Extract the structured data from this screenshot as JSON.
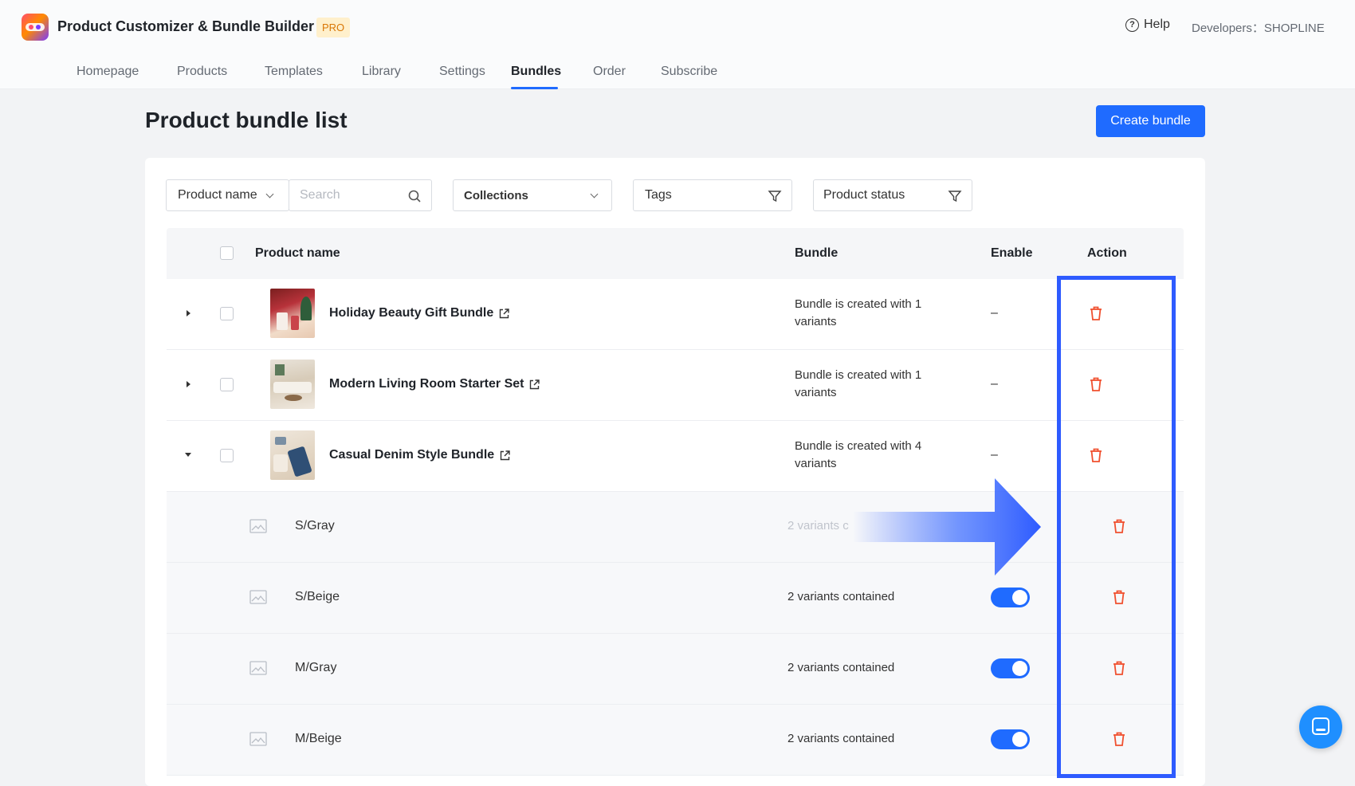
{
  "app": {
    "title": "Product Customizer & Bundle Builder",
    "badge": "PRO",
    "help_label": "Help",
    "developers_label": "Developers：SHOPLINE"
  },
  "nav": {
    "tabs": [
      "Homepage",
      "Products",
      "Templates",
      "Library",
      "Settings",
      "Bundles",
      "Order",
      "Subscribe"
    ],
    "active": "Bundles"
  },
  "page": {
    "title": "Product bundle list",
    "create_button": "Create bundle"
  },
  "filters": {
    "product_name_select": "Product name",
    "search_placeholder": "Search",
    "collections": "Collections",
    "tags": "Tags",
    "product_status": "Product status"
  },
  "table": {
    "headers": {
      "product_name": "Product name",
      "bundle": "Bundle",
      "enable": "Enable",
      "action": "Action"
    },
    "products": [
      {
        "name": "Holiday Beauty Gift Bundle",
        "bundle_line1": "Bundle is created with 1",
        "bundle_line2": "variants",
        "enable": "–",
        "expanded": false
      },
      {
        "name": "Modern Living Room Starter Set",
        "bundle_line1": "Bundle is created with 1",
        "bundle_line2": "variants",
        "enable": "–",
        "expanded": false
      },
      {
        "name": "Casual Denim Style Bundle",
        "bundle_line1": "Bundle is created with 4",
        "bundle_line2": "variants",
        "enable": "–",
        "expanded": true
      }
    ],
    "variants": [
      {
        "name": "S/Gray",
        "bundle": "2 variants c",
        "enabled": true
      },
      {
        "name": "S/Beige",
        "bundle": "2 variants contained",
        "enabled": true
      },
      {
        "name": "M/Gray",
        "bundle": "2 variants contained",
        "enabled": true
      },
      {
        "name": "M/Beige",
        "bundle": "2 variants contained",
        "enabled": true
      }
    ]
  },
  "colors": {
    "primary": "#1f6bff",
    "danger": "#f0502f",
    "highlight": "#2e5bff"
  },
  "icons": {
    "trash": "trash-icon",
    "external_link": "external-link-icon",
    "search": "search-icon",
    "filter": "filter-icon",
    "image_placeholder": "image-placeholder-icon",
    "chat": "chat-icon"
  }
}
